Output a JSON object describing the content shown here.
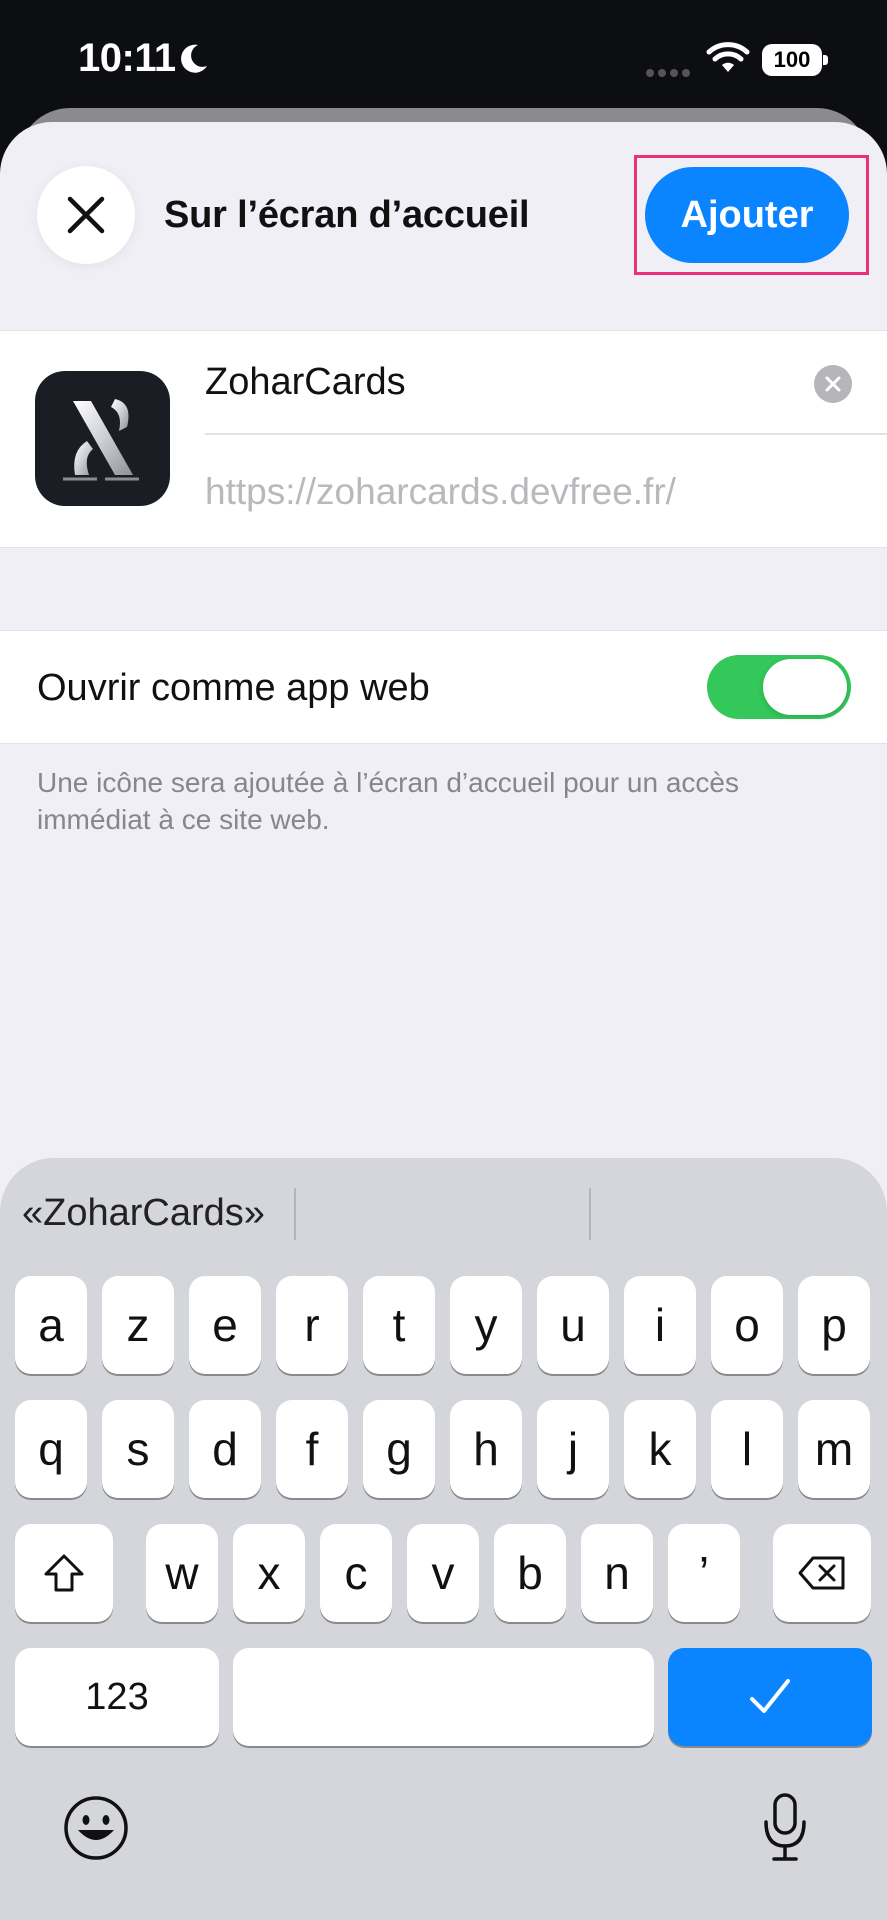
{
  "status_bar": {
    "time": "10:11",
    "battery": "100"
  },
  "sheet": {
    "title": "Sur l’écran d’accueil",
    "add_label": "Ajouter"
  },
  "app": {
    "name": "ZoharCards",
    "url": "https://zoharcards.devfree.fr/"
  },
  "option": {
    "label": "Ouvrir comme app web",
    "enabled": true,
    "footnote": "Une icône sera ajoutée à l’écran d’accueil pour un accès immédiat à ce site web."
  },
  "keyboard": {
    "suggestion": "«ZoharCards»",
    "row1": [
      "a",
      "z",
      "e",
      "r",
      "t",
      "y",
      "u",
      "i",
      "o",
      "p"
    ],
    "row2": [
      "q",
      "s",
      "d",
      "f",
      "g",
      "h",
      "j",
      "k",
      "l",
      "m"
    ],
    "row3": [
      "w",
      "x",
      "c",
      "v",
      "b",
      "n",
      "’"
    ],
    "numbers_label": "123"
  },
  "colors": {
    "accent": "#0a84ff",
    "toggle_on": "#34c759",
    "highlight": "#e8307c"
  }
}
